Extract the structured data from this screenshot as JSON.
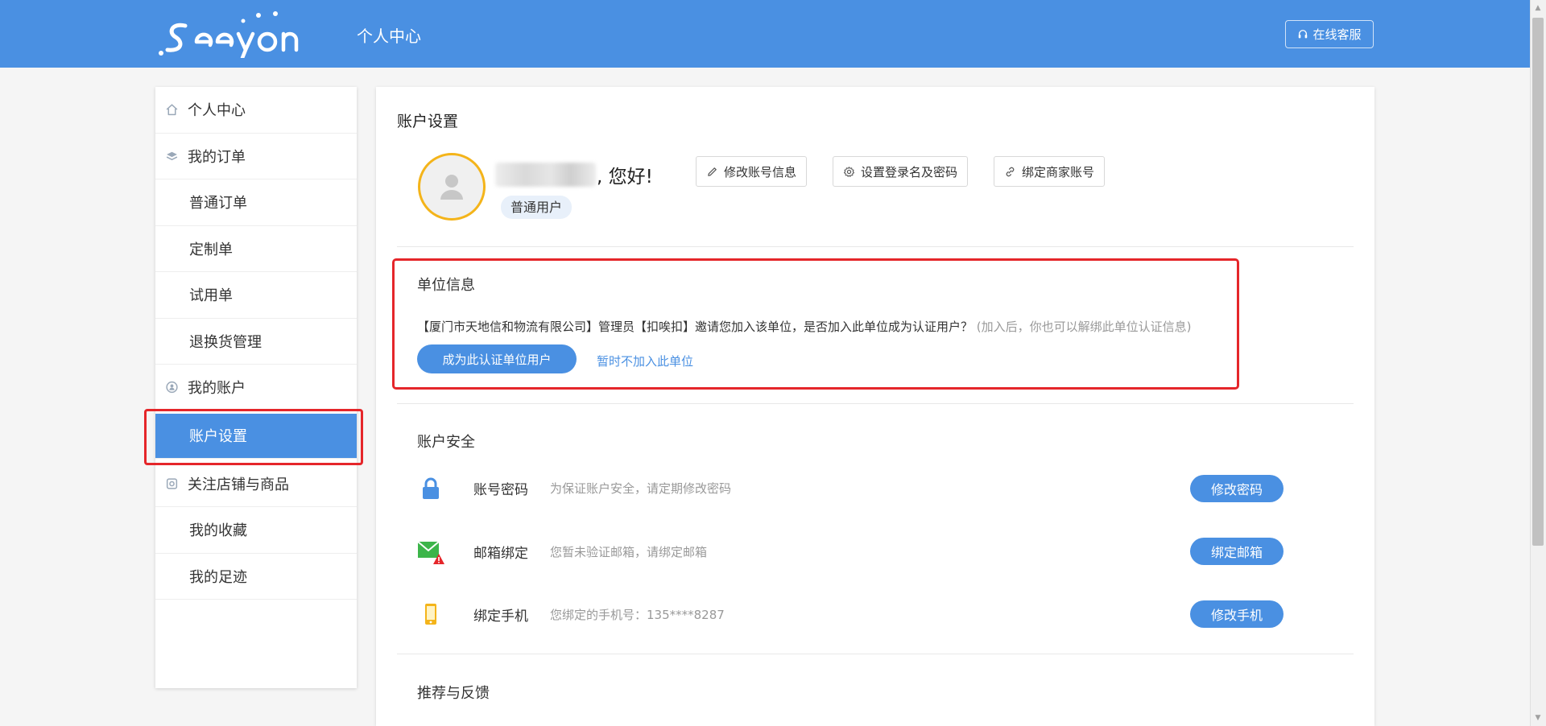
{
  "header": {
    "title": "个人中心",
    "support_label": "在线客服",
    "brand_color": "#4a90e2"
  },
  "sidebar": {
    "items": [
      {
        "label": "个人中心",
        "icon": "home-icon"
      },
      {
        "label": "我的订单",
        "icon": "layers-icon"
      },
      {
        "label": "普通订单"
      },
      {
        "label": "定制单"
      },
      {
        "label": "试用单"
      },
      {
        "label": "退换货管理"
      },
      {
        "label": "我的账户",
        "icon": "user-circle-icon"
      },
      {
        "label": "账户设置",
        "active": true
      },
      {
        "label": "关注店铺与商品",
        "icon": "store-icon"
      },
      {
        "label": "我的收藏"
      },
      {
        "label": "我的足迹"
      }
    ]
  },
  "main": {
    "title": "账户设置",
    "profile": {
      "greeting": ", 您好!",
      "user_type": "普通用户",
      "buttons": [
        {
          "label": "修改账号信息",
          "icon": "pencil-icon"
        },
        {
          "label": "设置登录名及密码",
          "icon": "gear-icon"
        },
        {
          "label": "绑定商家账号",
          "icon": "link-icon"
        }
      ]
    },
    "unit": {
      "title": "单位信息",
      "message": "【厦门市天地信和物流有限公司】管理员【扣唉扣】邀请您加入该单位，是否加入此单位成为认证用户？",
      "note": "(加入后，你也可以解绑此单位认证信息)",
      "join_label": "成为此认证单位用户",
      "later_label": "暂时不加入此单位"
    },
    "security": {
      "title": "账户安全",
      "rows": [
        {
          "label": "账号密码",
          "desc": "为保证账户安全，请定期修改密码",
          "button": "修改密码",
          "icon": "lock-icon"
        },
        {
          "label": "邮箱绑定",
          "desc": "您暂未验证邮箱，请绑定邮箱",
          "button": "绑定邮箱",
          "icon": "mail-warning-icon"
        },
        {
          "label": "绑定手机",
          "desc": "您绑定的手机号：135****8287",
          "button": "修改手机",
          "icon": "phone-icon"
        }
      ]
    },
    "recommend": {
      "title": "推荐与反馈"
    }
  }
}
